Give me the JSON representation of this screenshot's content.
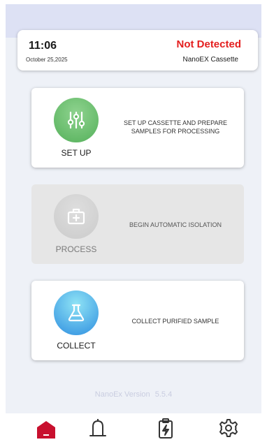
{
  "status": {
    "time": "11:06",
    "detection": "Not Detected",
    "date": "October 25,2025",
    "device": "NanoEX Cassette"
  },
  "cards": [
    {
      "title": "SET UP",
      "description": "SET UP CASSETTE AND PREPARE SAMPLES FOR PROCESSING",
      "icon": "sliders-icon",
      "color": "#5cb85c",
      "enabled": true
    },
    {
      "title": "PROCESS",
      "description": "BEGIN AUTOMATIC ISOLATION",
      "icon": "medkit-icon",
      "color": "#d3d3d3",
      "enabled": false
    },
    {
      "title": "COLLECT",
      "description": "COLLECT PURIFIED SAMPLE",
      "icon": "flask-icon",
      "color": "#3aa0e8",
      "enabled": true
    }
  ],
  "footer": {
    "version_label": "NanoEx Version",
    "version_number": "5.5.4"
  },
  "nav": [
    {
      "icon": "home-icon",
      "active": true,
      "color": "#c8102e"
    },
    {
      "icon": "bell-icon",
      "active": false
    },
    {
      "icon": "clipboard-charge-icon",
      "active": false
    },
    {
      "icon": "gear-icon",
      "active": false
    }
  ],
  "colors": {
    "accent": "#c8102e",
    "alert": "#e41e1e",
    "background": "#eef1f7"
  }
}
